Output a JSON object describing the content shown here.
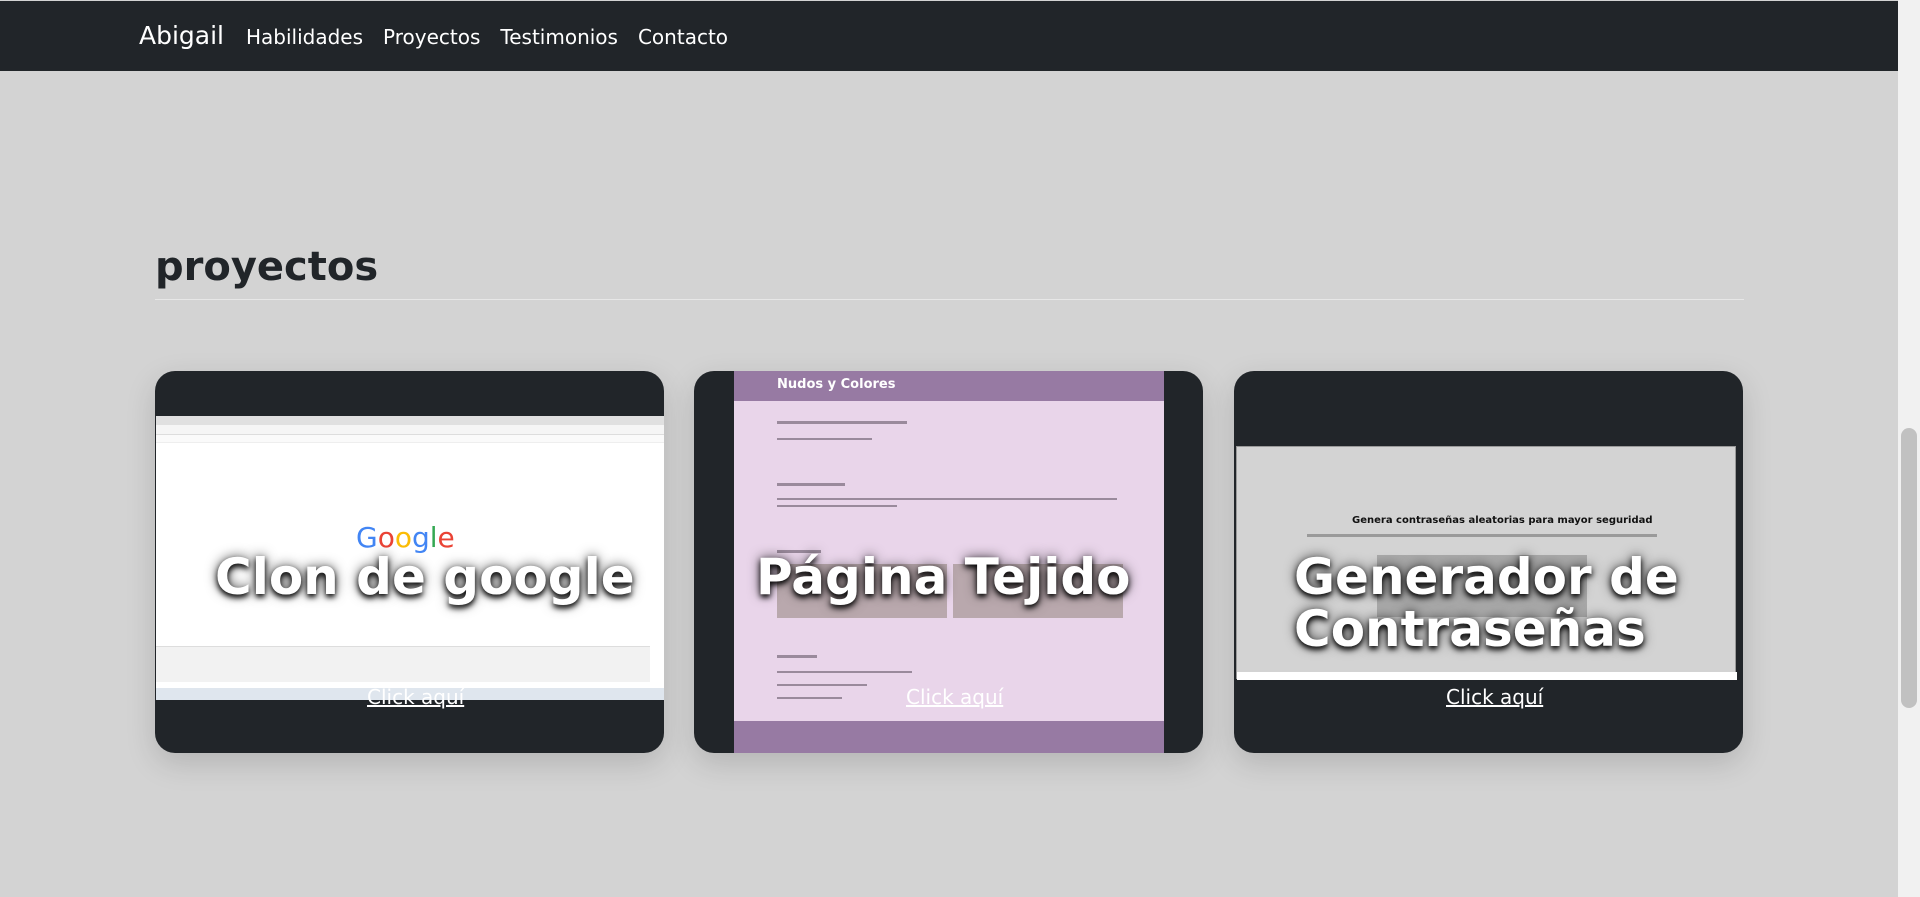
{
  "navbar": {
    "brand": "Abigail",
    "links": [
      "Habilidades",
      "Proyectos",
      "Testimonios",
      "Contacto"
    ]
  },
  "section": {
    "title": "proyectos"
  },
  "projects": [
    {
      "title": "Clon de google",
      "link": "Click aquí",
      "preview_logo": "Google"
    },
    {
      "title": "Página Tejido",
      "link": "Click aquí",
      "preview_brand": "Nudos y Colores"
    },
    {
      "title_line1": "Generador de",
      "title_line2": "Contraseñas",
      "link": "Click aquí",
      "preview_heading": "Genera contraseñas aleatorias para mayor seguridad"
    }
  ],
  "colors": {
    "navbar": "#212529",
    "background": "#d3d3d3",
    "card": "#212529",
    "knit_header": "#977aa3"
  }
}
